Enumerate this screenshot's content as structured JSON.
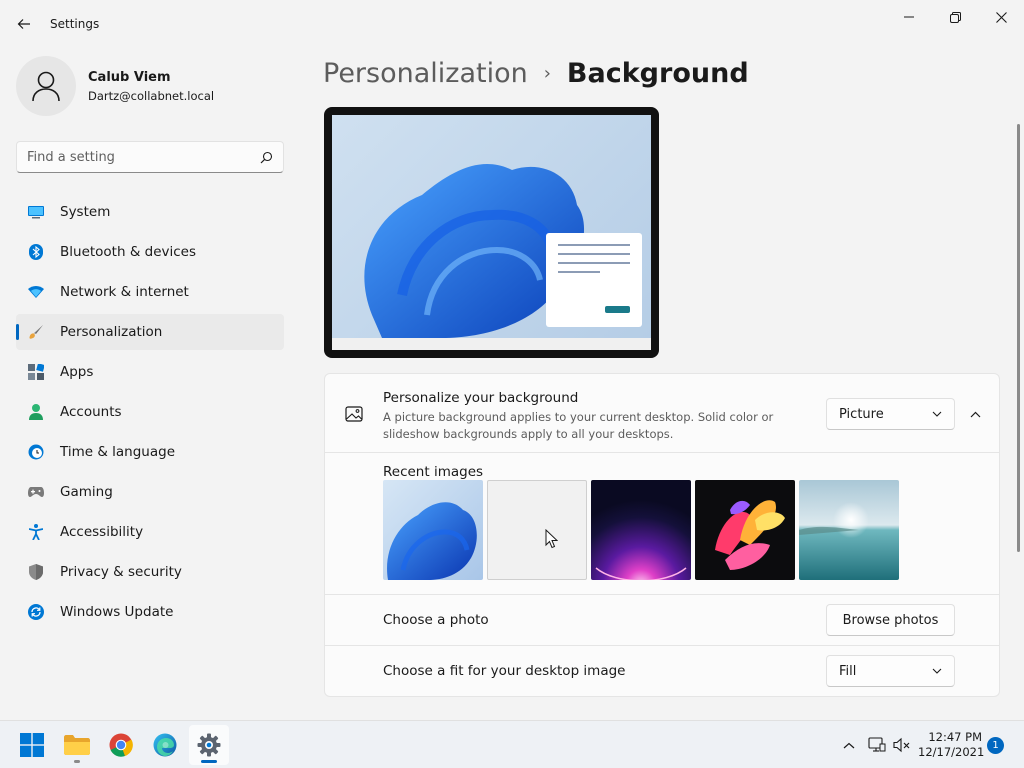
{
  "window": {
    "title": "Settings",
    "back_icon": "arrow-left-icon",
    "controls": [
      "minimize-icon",
      "maximize-icon",
      "close-icon"
    ]
  },
  "profile": {
    "name": "Calub Viem",
    "email": "Dartz@collabnet.local",
    "avatar_icon": "person-icon"
  },
  "search": {
    "placeholder": "Find a setting",
    "icon": "search-icon"
  },
  "nav": {
    "items": [
      {
        "label": "System",
        "icon": "monitor-icon",
        "color": "#0078d4"
      },
      {
        "label": "Bluetooth & devices",
        "icon": "bluetooth-icon",
        "color": "#0078d4"
      },
      {
        "label": "Network & internet",
        "icon": "wifi-icon",
        "color": "#0078d4"
      },
      {
        "label": "Personalization",
        "icon": "brush-icon",
        "color": "#e8a33d",
        "active": true
      },
      {
        "label": "Apps",
        "icon": "apps-icon",
        "color": "#5c6b7a"
      },
      {
        "label": "Accounts",
        "icon": "account-icon",
        "color": "#2bb673"
      },
      {
        "label": "Time & language",
        "icon": "clock-globe-icon",
        "color": "#0078d4"
      },
      {
        "label": "Gaming",
        "icon": "gamepad-icon",
        "color": "#6b6b6b"
      },
      {
        "label": "Accessibility",
        "icon": "accessibility-icon",
        "color": "#0078d4"
      },
      {
        "label": "Privacy & security",
        "icon": "shield-icon",
        "color": "#6b6b6b"
      },
      {
        "label": "Windows Update",
        "icon": "update-icon",
        "color": "#0078d4"
      }
    ]
  },
  "breadcrumb": {
    "parent": "Personalization",
    "separator": "›",
    "current": "Background"
  },
  "background_card": {
    "title": "Personalize your background",
    "description": "A picture background applies to your current desktop. Solid color or slideshow backgrounds apply to all your desktops.",
    "icon": "picture-icon",
    "dropdown_value": "Picture",
    "expand_icon": "chevron-up-icon"
  },
  "recent_images": {
    "label": "Recent images",
    "items": [
      "bloom-blue",
      "empty-slot",
      "glow-purple",
      "ribbon-colorful",
      "lake-sunrise"
    ]
  },
  "choose_photo": {
    "label": "Choose a photo",
    "button": "Browse photos"
  },
  "fit": {
    "label": "Choose a fit for your desktop image",
    "dropdown_value": "Fill"
  },
  "taskbar": {
    "apps": [
      "windows-start-icon",
      "file-explorer-icon",
      "chrome-icon",
      "edge-icon",
      "settings-gear-icon"
    ],
    "active_app": "settings-gear-icon",
    "tray": [
      "chevron-up-icon",
      "network-icon",
      "volume-muted-icon"
    ],
    "time": "12:47 PM",
    "date": "12/17/2021",
    "notification_count": "1"
  },
  "colors": {
    "accent": "#0067c0",
    "background": "#f3f3f3",
    "card": "#fbfbfb"
  }
}
